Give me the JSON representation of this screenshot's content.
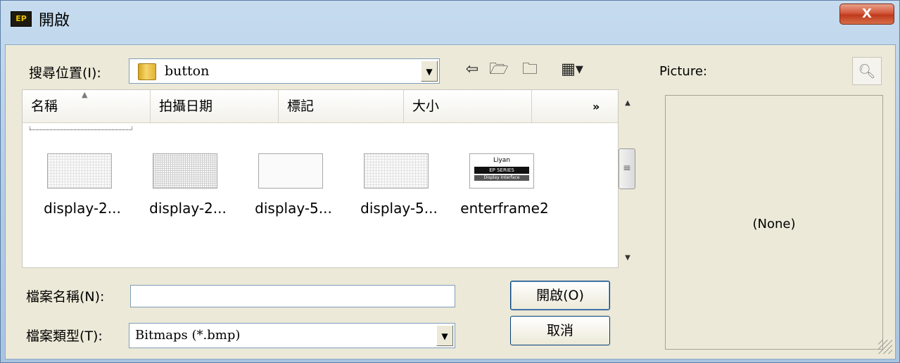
{
  "window": {
    "title": "開啟",
    "app_icon_text": "EP",
    "close_label": "X",
    "frame_color": "#b4cde6",
    "close_color": "#c0391d"
  },
  "lookin": {
    "label": "搜尋位置(I):",
    "value": "button"
  },
  "toolbar": {
    "icons": [
      "back-arrow-icon",
      "up-folder-icon",
      "new-folder-icon",
      "view-menu-icon"
    ]
  },
  "list": {
    "columns": [
      "名稱",
      "拍攝日期",
      "標記",
      "大小"
    ],
    "more_label": "»",
    "items": [
      {
        "label": "display-2...",
        "thumb": "grid"
      },
      {
        "label": "display-2...",
        "thumb": "grid2"
      },
      {
        "label": "display-5...",
        "thumb": "blank"
      },
      {
        "label": "display-5...",
        "thumb": "grid"
      },
      {
        "label": "enterframe2",
        "thumb": "logo"
      }
    ],
    "logo_text": {
      "brand": "Liyan",
      "series": "EP SERIES",
      "sub": "Display Interface"
    }
  },
  "filename": {
    "label": "檔案名稱(N):",
    "value": ""
  },
  "filetype": {
    "label": "檔案類型(T):",
    "value": "Bitmaps (*.bmp)"
  },
  "buttons": {
    "open": "開啟(O)",
    "cancel": "取消"
  },
  "preview": {
    "label": "Picture:",
    "none_text": "(None)"
  }
}
